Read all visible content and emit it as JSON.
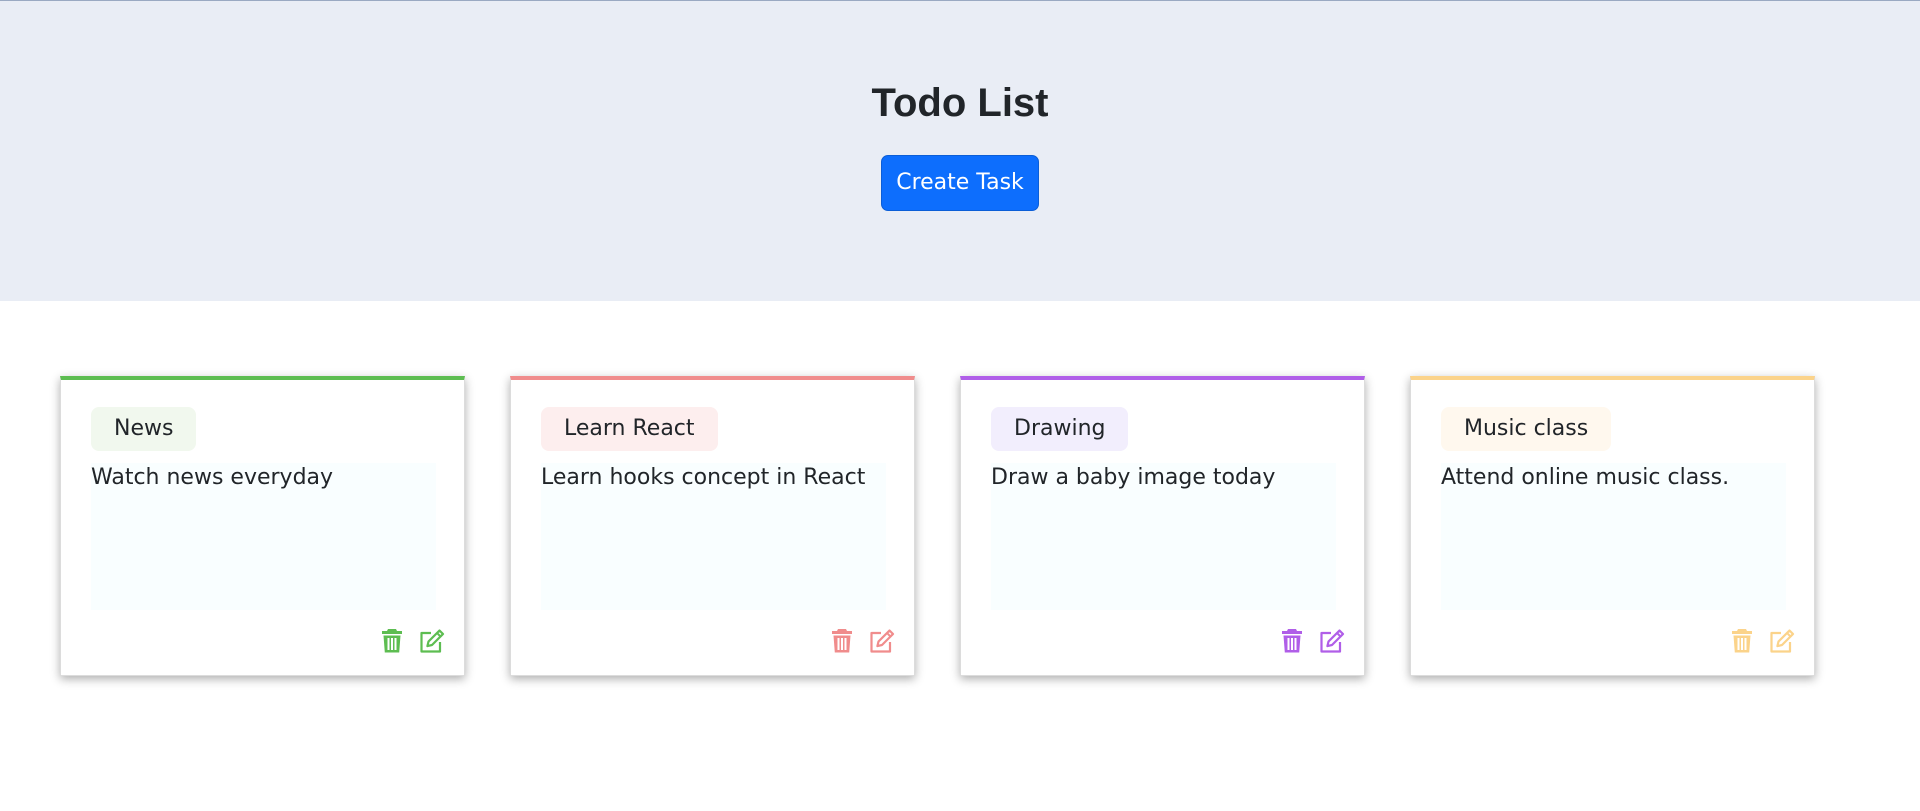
{
  "header": {
    "title": "Todo List",
    "create_button_label": "Create Task"
  },
  "colors": {
    "header_background": "#e9edf5",
    "primary_button": "#0d6efd"
  },
  "tasks": [
    {
      "tag": "News",
      "description": "Watch news everyday",
      "accent_color": "#5dbd51",
      "tag_background": "#f1f8ee",
      "icons": [
        "trash-icon",
        "edit-icon"
      ]
    },
    {
      "tag": "Learn React",
      "description": "Learn hooks concept in React",
      "accent_color": "#f08c8c",
      "tag_background": "#fdeeee",
      "icons": [
        "trash-icon",
        "edit-icon"
      ]
    },
    {
      "tag": "Drawing",
      "description": "Draw a baby image today",
      "accent_color": "#b05ee8",
      "tag_background": "#f2eefd",
      "icons": [
        "trash-icon",
        "edit-icon"
      ]
    },
    {
      "tag": "Music class",
      "description": "Attend online music class.",
      "accent_color": "#fbd38a",
      "tag_background": "#fff8ee",
      "icons": [
        "trash-icon",
        "edit-icon"
      ]
    }
  ]
}
